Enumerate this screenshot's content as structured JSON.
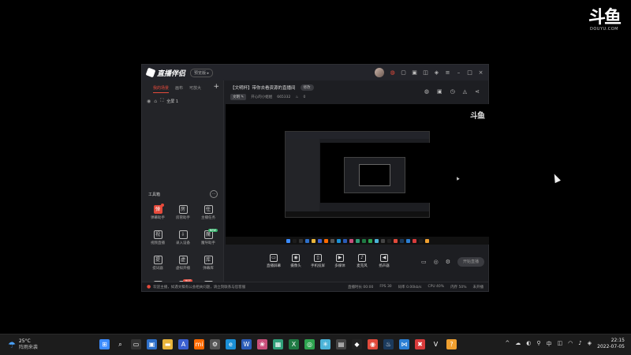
{
  "watermark": {
    "logo": "斗鱼",
    "sub": "DOUYU.COM"
  },
  "app": {
    "name": "直播伴侣",
    "version_badge": "预览版 ▸",
    "titlebar_icons": [
      "avatar",
      "gift-icon",
      "box-icon",
      "bag-icon",
      "chart-icon",
      "skin-icon",
      "menu-icon",
      "minimize-icon",
      "maximize-icon",
      "close-icon"
    ]
  },
  "scene_panel": {
    "tabs": [
      "我的场景",
      "画布",
      "可放大"
    ],
    "add": "+",
    "rows": [
      {
        "label": "全屏 1"
      }
    ]
  },
  "tools": {
    "title": "工具箱",
    "more": "···",
    "items": [
      {
        "label": "弹幕助手",
        "glyph": "弹",
        "red": true,
        "badge": "",
        "dot": true
      },
      {
        "label": "房管助手",
        "glyph": "房",
        "red": false,
        "badge": "",
        "dot": false
      },
      {
        "label": "主播任务",
        "glyph": "任",
        "red": false,
        "badge": "",
        "dot": false
      },
      {
        "label": "视频直播",
        "glyph": "视",
        "red": false,
        "badge": "",
        "dot": false
      },
      {
        "label": "录入设备",
        "glyph": "⇩",
        "red": false,
        "badge": "",
        "dot": false
      },
      {
        "label": "魔导助手",
        "glyph": "魔",
        "red": false,
        "badge": "NEW",
        "dot": false
      },
      {
        "label": "提词器",
        "glyph": "提",
        "red": false,
        "badge": "",
        "dot": false
      },
      {
        "label": "虚拟开播",
        "glyph": "虚",
        "red": false,
        "badge": "",
        "dot": false
      },
      {
        "label": "弹幕库",
        "glyph": "库",
        "red": false,
        "badge": "",
        "dot": false
      },
      {
        "label": "",
        "glyph": "▤",
        "red": false,
        "badge": "",
        "dot": false
      },
      {
        "label": "",
        "glyph": "▣",
        "red": false,
        "badge": "HOT",
        "dot": false
      },
      {
        "label": "",
        "glyph": "⇩",
        "red": false,
        "badge": "",
        "dot": false
      }
    ]
  },
  "room": {
    "title": "【文明杯】带你去看资源的直播间",
    "edit": "修改",
    "category": "文明 ✎",
    "anchor": "开心的小姐姐",
    "room_id": "665332",
    "hot": "0"
  },
  "preview": {
    "watermark": "斗鱼"
  },
  "toolbar": {
    "items": [
      {
        "label": "直播屏幕",
        "glyph": "▭"
      },
      {
        "label": "摄像头",
        "glyph": "◉"
      },
      {
        "label": "手机投屏",
        "glyph": "▯"
      },
      {
        "label": "多媒体",
        "glyph": "▶"
      },
      {
        "label": "麦克风",
        "glyph": "♪"
      },
      {
        "label": "扬声器",
        "glyph": "◀"
      }
    ],
    "live_button": "开始直播"
  },
  "status": {
    "notice": "欢迎主播，如遇文稿有公会相关问题，请立刻联系与您客服",
    "stats": [
      "直播时长 00:00",
      "FPS 30",
      "码率 0.00kb/s",
      "CPU 40%",
      "内存 50%",
      "未开播"
    ]
  },
  "taskbar": {
    "weather_temp": "25°C",
    "weather_desc": "阵雨来袭",
    "apps": [
      {
        "name": "start-icon",
        "glyph": "⊞",
        "color": "#3b8bff"
      },
      {
        "name": "search-icon",
        "glyph": "⌕",
        "color": "#1c1c1c"
      },
      {
        "name": "taskview-icon",
        "glyph": "▭",
        "color": "#333333"
      },
      {
        "name": "photos-icon",
        "glyph": "▣",
        "color": "#2d6fc9"
      },
      {
        "name": "explorer-icon",
        "glyph": "▬",
        "color": "#e9b43b"
      },
      {
        "name": "ai-icon",
        "glyph": "A",
        "color": "#3a5fd0"
      },
      {
        "name": "mi-icon",
        "glyph": "mi",
        "color": "#ff6a00"
      },
      {
        "name": "settings-icon",
        "glyph": "⚙",
        "color": "#555555"
      },
      {
        "name": "edge-icon",
        "glyph": "e",
        "color": "#1a8fd6"
      },
      {
        "name": "word-icon",
        "glyph": "W",
        "color": "#2b5cb8"
      },
      {
        "name": "game-icon",
        "glyph": "❀",
        "color": "#c84e7a"
      },
      {
        "name": "photo2-icon",
        "glyph": "▦",
        "color": "#30a07a"
      },
      {
        "name": "excel-icon",
        "glyph": "X",
        "color": "#1f7a44"
      },
      {
        "name": "chrome-icon",
        "glyph": "◎",
        "color": "#2ea44f"
      },
      {
        "name": "app-icon",
        "glyph": "✳",
        "color": "#4bb3d8"
      },
      {
        "name": "calc-icon",
        "glyph": "▤",
        "color": "#444444"
      },
      {
        "name": "controller-icon",
        "glyph": "◆",
        "color": "#222222"
      },
      {
        "name": "browser-icon",
        "glyph": "◉",
        "color": "#e24a3b"
      },
      {
        "name": "steam-icon",
        "glyph": "♨",
        "color": "#1b3a5c"
      },
      {
        "name": "vscode-icon",
        "glyph": "⋈",
        "color": "#2b7fd4"
      },
      {
        "name": "wps-icon",
        "glyph": "✖",
        "color": "#d83b3b"
      },
      {
        "name": "douyu-icon",
        "glyph": "V",
        "color": "#1c1c1c"
      },
      {
        "name": "douyu-companion-icon",
        "glyph": "?",
        "color": "#f0a030"
      }
    ],
    "tray": [
      "^",
      "☁",
      "◐",
      "⚲",
      "中",
      "◫",
      "◠",
      "♪",
      "◈"
    ],
    "time": "22:15",
    "date": "2022-07-05"
  }
}
